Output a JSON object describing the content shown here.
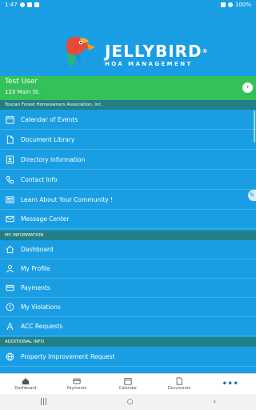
{
  "status_bar": {
    "time": "1:47",
    "battery": "100%"
  },
  "brand": {
    "title": "JELLYBIRD",
    "registered": "®",
    "subtitle": "HOA MANAGEMENT"
  },
  "user": {
    "name": "Test User",
    "address": "123 Main St."
  },
  "association": "Toucan Forest Homeowners Association, Inc.",
  "menu": [
    {
      "label": "Calendar of Events",
      "icon": "calendar-icon"
    },
    {
      "label": "Document Library",
      "icon": "document-icon"
    },
    {
      "label": "Directory Information",
      "icon": "contact-card-icon"
    },
    {
      "label": "Contact Info",
      "icon": "phone-icon"
    },
    {
      "label": "Learn About Your Community !",
      "icon": "newspaper-icon"
    },
    {
      "label": "Message Center",
      "icon": "mail-icon"
    }
  ],
  "my_info_section": "MY INFORMATION",
  "my_info": [
    {
      "label": "Dashboard",
      "icon": "home-icon"
    },
    {
      "label": "My Profile",
      "icon": "person-icon"
    },
    {
      "label": "Payments",
      "icon": "credit-card-icon"
    },
    {
      "label": "My Violations",
      "icon": "alert-icon"
    },
    {
      "label": "ACC Requests",
      "icon": "architecture-icon"
    }
  ],
  "additional_section": "ADDITIONAL INFO",
  "additional": [
    {
      "label": "Property Improvement Request",
      "icon": "globe-icon"
    }
  ],
  "bottom_nav": {
    "dashboard": "Dashboard",
    "payments": "Payments",
    "calendar": "Calendar",
    "documents": "Documents",
    "more": "•••"
  },
  "colors": {
    "primary": "#1a9ee3",
    "user_bar": "#35c15a",
    "section": "#237f86"
  }
}
